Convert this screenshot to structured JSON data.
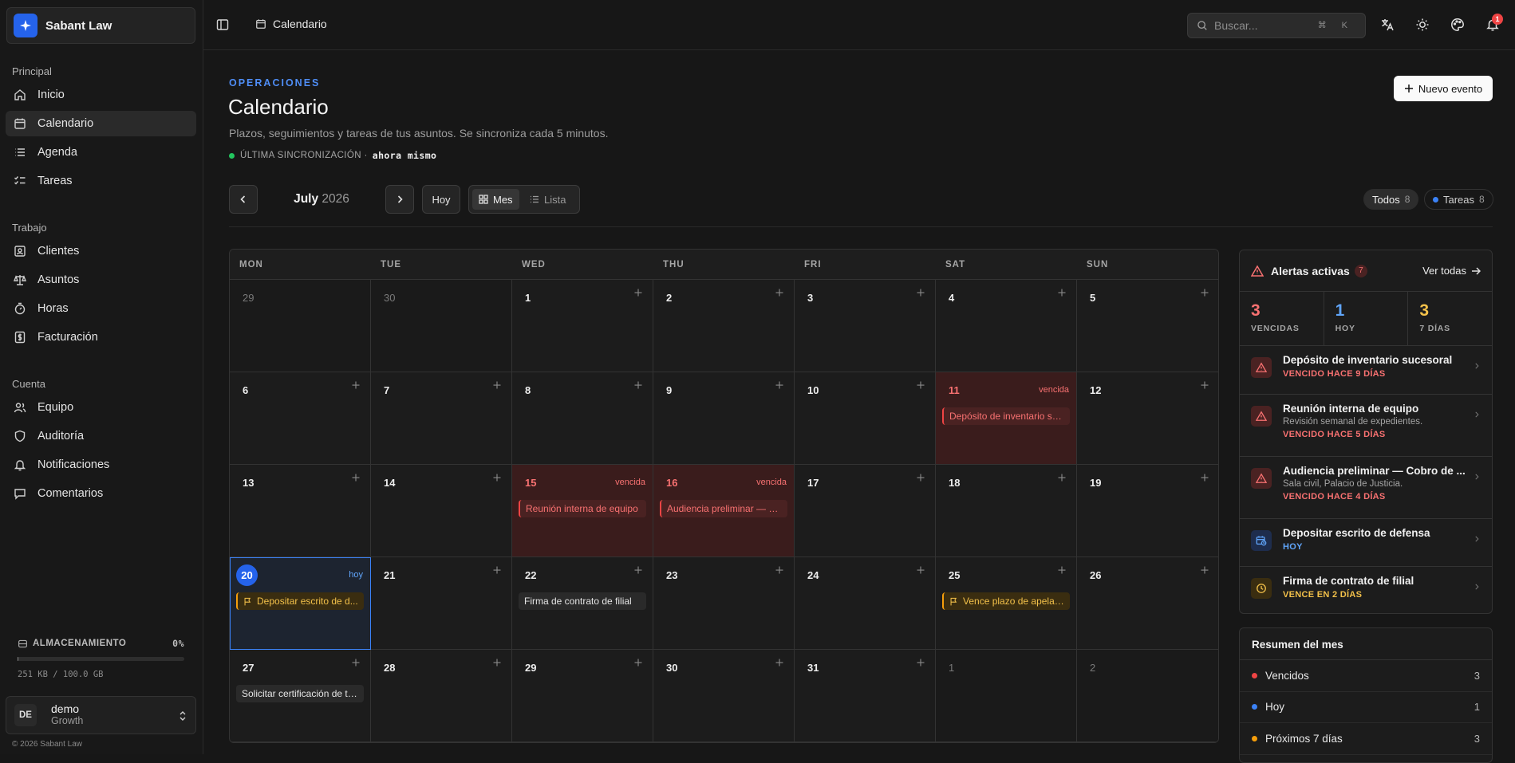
{
  "brand": {
    "name": "Sabant Law"
  },
  "nav": {
    "sections": [
      {
        "title": "Principal",
        "items": [
          "Inicio",
          "Calendario",
          "Agenda",
          "Tareas"
        ]
      },
      {
        "title": "Trabajo",
        "items": [
          "Clientes",
          "Asuntos",
          "Horas",
          "Facturación"
        ]
      },
      {
        "title": "Cuenta",
        "items": [
          "Equipo",
          "Auditoría",
          "Notificaciones",
          "Comentarios"
        ]
      }
    ],
    "active": "Calendario"
  },
  "storage": {
    "label": "ALMACENAMIENTO",
    "percent": "0%",
    "fill_fraction": 0.003,
    "usage": "251 KB / 100.0 GB"
  },
  "user": {
    "initials": "DE",
    "name": "demo",
    "plan": "Growth"
  },
  "footer": {
    "copyright": "© 2026 Sabant Law"
  },
  "topbar": {
    "breadcrumb": "Calendario",
    "search_placeholder": "Buscar...",
    "search_shortcut": "⌘ K",
    "notification_count": "1"
  },
  "header": {
    "eyebrow": "OPERACIONES",
    "title": "Calendario",
    "subtitle": "Plazos, seguimientos y tareas de tus asuntos. Se sincroniza cada 5 minutos.",
    "sync_label": "ÚLTIMA SINCRONIZACIÓN ·",
    "sync_value": "ahora mismo",
    "new_event": "Nuevo evento"
  },
  "toolbar": {
    "month": "July",
    "year": "2026",
    "today": "Hoy",
    "views": {
      "month": "Mes",
      "list": "Lista"
    },
    "filters": [
      {
        "label": "Todos",
        "count": "8"
      },
      {
        "label": "Tareas",
        "count": "8",
        "color": "#3b82f6"
      }
    ]
  },
  "calendar": {
    "weekdays": [
      "MON",
      "TUE",
      "WED",
      "THU",
      "FRI",
      "SAT",
      "SUN"
    ],
    "weeks": [
      [
        {
          "d": "29",
          "out": true
        },
        {
          "d": "30",
          "out": true
        },
        {
          "d": "1"
        },
        {
          "d": "2"
        },
        {
          "d": "3"
        },
        {
          "d": "4"
        },
        {
          "d": "5"
        }
      ],
      [
        {
          "d": "6"
        },
        {
          "d": "7"
        },
        {
          "d": "8"
        },
        {
          "d": "9"
        },
        {
          "d": "10"
        },
        {
          "d": "11",
          "status": "overdue",
          "tag": "vencida",
          "event": {
            "text": "Depósito de inventario suc...",
            "kind": "red"
          }
        },
        {
          "d": "12"
        }
      ],
      [
        {
          "d": "13"
        },
        {
          "d": "14"
        },
        {
          "d": "15",
          "status": "overdue",
          "tag": "vencida",
          "event": {
            "text": "Reunión interna de equipo",
            "kind": "red"
          }
        },
        {
          "d": "16",
          "status": "overdue",
          "tag": "vencida",
          "event": {
            "text": "Audiencia preliminar — Co...",
            "kind": "red"
          }
        },
        {
          "d": "17"
        },
        {
          "d": "18"
        },
        {
          "d": "19"
        }
      ],
      [
        {
          "d": "20",
          "status": "today",
          "tag": "hoy",
          "event": {
            "text": "Depositar escrito de d...",
            "kind": "amber",
            "flag": true
          }
        },
        {
          "d": "21"
        },
        {
          "d": "22",
          "event": {
            "text": "Firma de contrato de filial",
            "kind": "plain"
          }
        },
        {
          "d": "23"
        },
        {
          "d": "24"
        },
        {
          "d": "25",
          "event": {
            "text": "Vence plazo de apelaci...",
            "kind": "amber",
            "flag": true
          }
        },
        {
          "d": "26"
        }
      ],
      [
        {
          "d": "27",
          "event": {
            "text": "Solicitar certificación de tí...",
            "kind": "plain"
          }
        },
        {
          "d": "28"
        },
        {
          "d": "29"
        },
        {
          "d": "30"
        },
        {
          "d": "31"
        },
        {
          "d": "1",
          "out": true
        },
        {
          "d": "2",
          "out": true
        }
      ]
    ]
  },
  "alerts": {
    "title": "Alertas activas",
    "count": "7",
    "view_all": "Ver todas",
    "stats": [
      {
        "value": "3",
        "label": "VENCIDAS",
        "color": "#f87171"
      },
      {
        "value": "1",
        "label": "HOY",
        "color": "#60a5fa"
      },
      {
        "value": "3",
        "label": "7 DÍAS",
        "color": "#f3c14a"
      }
    ],
    "items": [
      {
        "title": "Depósito de inventario sucesoral",
        "desc": "",
        "status": "VENCIDO HACE 9 DÍAS",
        "kind": "red",
        "icon": "warning-icon"
      },
      {
        "title": "Reunión interna de equipo",
        "desc": "Revisión semanal de expedientes.",
        "status": "VENCIDO HACE 5 DÍAS",
        "kind": "red",
        "icon": "warning-icon"
      },
      {
        "title": "Audiencia preliminar — Cobro de ...",
        "desc": "Sala civil, Palacio de Justicia.",
        "status": "VENCIDO HACE 4 DÍAS",
        "kind": "red",
        "icon": "warning-icon"
      },
      {
        "title": "Depositar escrito de defensa",
        "desc": "",
        "status": "HOY",
        "kind": "blue",
        "icon": "calendar-clock-icon"
      },
      {
        "title": "Firma de contrato de filial",
        "desc": "",
        "status": "VENCE EN 2 DÍAS",
        "kind": "amber",
        "icon": "clock-icon"
      }
    ]
  },
  "summary": {
    "title": "Resumen del mes",
    "rows": [
      {
        "label": "Vencidos",
        "count": "3",
        "color": "#ef4444"
      },
      {
        "label": "Hoy",
        "count": "1",
        "color": "#3b82f6"
      },
      {
        "label": "Próximos 7 días",
        "count": "3",
        "color": "#f59e0b"
      }
    ]
  },
  "colors": {
    "accent": "#2563eb",
    "overdue": "#ef4444",
    "today": "#3b82f6",
    "soon": "#f59e0b"
  }
}
